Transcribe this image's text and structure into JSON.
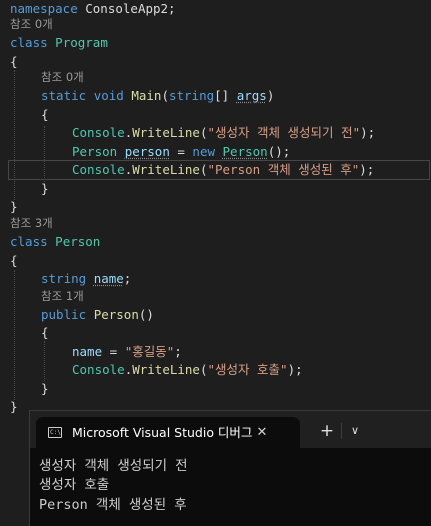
{
  "editor": {
    "namespace_kw": "namespace",
    "namespace_name": " ConsoleApp2;",
    "lens_program": "참조 0개",
    "class_kw": "class",
    "program_name": "Program",
    "open_brace": "{",
    "close_brace": "}",
    "lens_main": "참조 0개",
    "static_kw": "static",
    "void_kw": "void",
    "main_name": "Main",
    "string_kw": "string",
    "args_decl": "[] ",
    "args_name": "args",
    "main_close_paren": ")",
    "console": "Console",
    "dot": ".",
    "writeline": "WriteLine",
    "str_before": "\"생성자 객체 생성되기 전\"",
    "str_after": "\"Person 객체 생성된 후\"",
    "call_end": ");",
    "open_paren": "(",
    "person_type": "Person",
    "person_var": "person",
    "eq": " = ",
    "new_kw": "new",
    "ctor_call": "()",
    "lens_person": "참조 3개",
    "person_class_name": "Person",
    "field_type": "string",
    "field_name": "name",
    "semicolon": ";",
    "lens_ctor": "참조 1개",
    "public_kw": "public",
    "ctor_name": "Person",
    "ctor_parens": "()",
    "assign_target": "name",
    "str_name": "\"홍길동\"",
    "str_ctor": "\"생성자 호출\""
  },
  "terminal": {
    "tab_title": "Microsoft Visual Studio 디버그",
    "tab_icon_text": "C:\\",
    "close_glyph": "✕",
    "new_tab_glyph": "+",
    "dropdown_glyph": "∨",
    "output": [
      "생성자 객체 생성되기 전",
      "생성자 호출",
      "Person 객체 생성된 후"
    ]
  }
}
